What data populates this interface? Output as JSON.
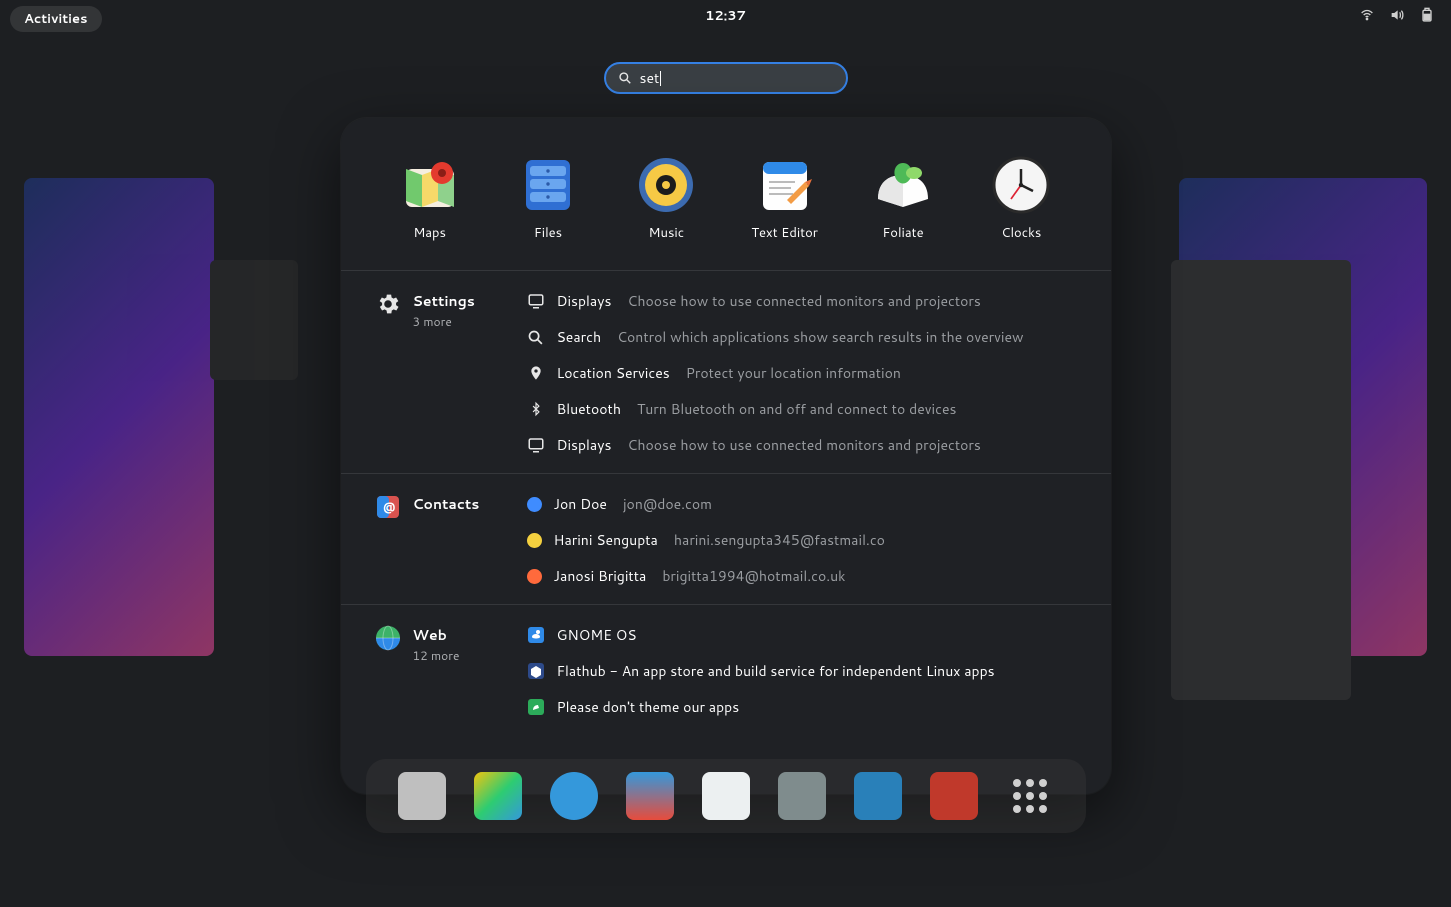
{
  "topbar": {
    "activities": "Activities",
    "clock": "12:37"
  },
  "search": {
    "query": "set"
  },
  "apps": [
    {
      "id": "maps",
      "label": "Maps"
    },
    {
      "id": "files",
      "label": "Files"
    },
    {
      "id": "music",
      "label": "Music"
    },
    {
      "id": "texteditor",
      "label": "Text Editor"
    },
    {
      "id": "foliate",
      "label": "Foliate"
    },
    {
      "id": "clocks",
      "label": "Clocks"
    }
  ],
  "sections": {
    "settings": {
      "name": "Settings",
      "more": "3 more",
      "rows": [
        {
          "icon": "monitor",
          "title": "Displays",
          "desc": "Choose how to use connected monitors and projectors"
        },
        {
          "icon": "search",
          "title": "Search",
          "desc": "Control which applications show search results in the overview"
        },
        {
          "icon": "location",
          "title": "Location Services",
          "desc": "Protect your location information"
        },
        {
          "icon": "bluetooth",
          "title": "Bluetooth",
          "desc": "Turn Bluetooth on and off and connect to devices"
        },
        {
          "icon": "monitor",
          "title": "Displays",
          "desc": "Choose how to use connected monitors and projectors"
        }
      ]
    },
    "contacts": {
      "name": "Contacts",
      "rows": [
        {
          "color": "#3f8cff",
          "title": "Jon Doe",
          "desc": "jon@doe.com"
        },
        {
          "color": "#f4d03f",
          "title": "Harini Sengupta",
          "desc": "harini.sengupta345@fastmail.co"
        },
        {
          "color": "#ff6a3c",
          "title": "Janosi Brigitta",
          "desc": "brigitta1994@hotmail.co.uk"
        }
      ]
    },
    "web": {
      "name": "Web",
      "more": "12 more",
      "rows": [
        {
          "favicon": "gnome",
          "title": "GNOME OS"
        },
        {
          "favicon": "flathub",
          "title": "Flathub - An app store and build service for independent Linux apps"
        },
        {
          "favicon": "theme",
          "title": "Please don't theme our apps"
        }
      ]
    }
  }
}
